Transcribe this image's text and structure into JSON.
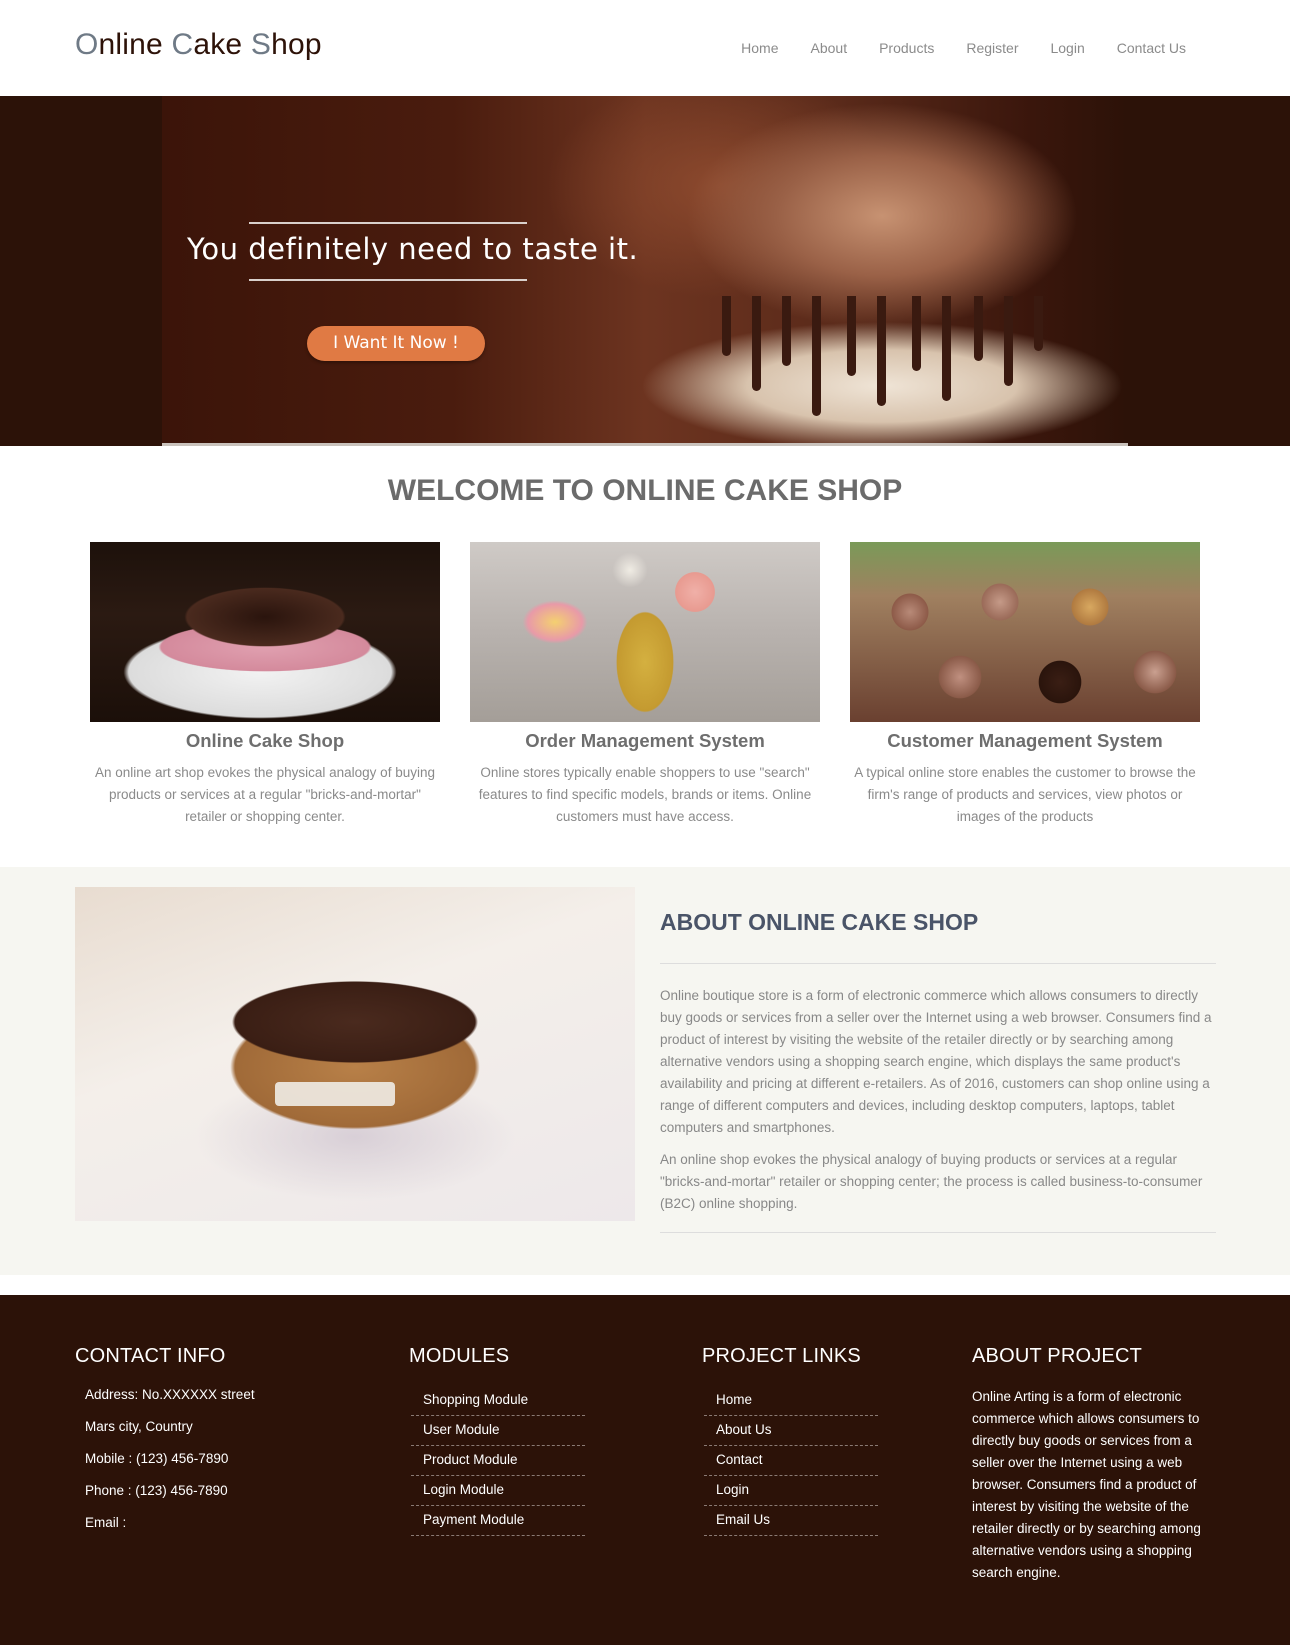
{
  "header": {
    "logo_parts": [
      {
        "cap": "O",
        "rest": "nline "
      },
      {
        "cap": "C",
        "rest": "ake "
      },
      {
        "cap": "S",
        "rest": "hop"
      }
    ],
    "nav": [
      "Home",
      "About",
      "Products",
      "Register",
      "Login",
      "Contact Us"
    ]
  },
  "hero": {
    "tagline": "You definitely need to taste it.",
    "cta_label": "I Want It Now !",
    "cta_color": "#e07a44"
  },
  "welcome": {
    "title": "WELCOME TO ONLINE CAKE SHOP",
    "cards": [
      {
        "title": "Online Cake Shop",
        "text": "An online art shop evokes the physical analogy of buying products or services at a regular \"bricks-and-mortar\" retailer or shopping center."
      },
      {
        "title": "Order Management System",
        "text": "Online stores typically enable shoppers to use \"search\" features to find specific models, brands or items. Online customers must have access."
      },
      {
        "title": "Customer Management System",
        "text": "A typical online store enables the customer to browse the firm's range of products and services, view photos or images of the products"
      }
    ]
  },
  "about": {
    "title": "ABOUT ONLINE CAKE SHOP",
    "paragraphs": [
      "Online boutique store is a form of electronic commerce which allows consumers to directly buy goods or services from a seller over the Internet using a web browser. Consumers find a product of interest by visiting the website of the retailer directly or by searching among alternative vendors using a shopping search engine, which displays the same product's availability and pricing at different e-retailers. As of 2016, customers can shop online using a range of different computers and devices, including desktop computers, laptops, tablet computers and smartphones.",
      "An online shop evokes the physical analogy of buying products or services at a regular \"bricks-and-mortar\" retailer or shopping center; the process is called business-to-consumer (B2C) online shopping."
    ]
  },
  "footer": {
    "contact": {
      "title": "CONTACT INFO",
      "lines": [
        "Address: No.XXXXXX street",
        "Mars city, Country",
        "Mobile : (123) 456-7890",
        "Phone : (123) 456-7890",
        "Email :"
      ]
    },
    "modules": {
      "title": "MODULES",
      "items": [
        "Shopping Module",
        "User Module",
        "Product Module",
        "Login Module",
        "Payment Module"
      ]
    },
    "links": {
      "title": "PROJECT LINKS",
      "items": [
        "Home",
        "About Us",
        "Contact",
        "Login",
        "Email Us"
      ]
    },
    "about_project": {
      "title": "ABOUT PROJECT",
      "text": "Online Arting is a form of electronic commerce which allows consumers to directly buy goods or services from a seller over the Internet using a web browser. Consumers find a product of interest by visiting the website of the retailer directly or by searching among alternative vendors using a shopping search engine."
    }
  },
  "colors": {
    "brand_dark": "#2c1208",
    "accent": "#e07a44",
    "about_bg": "#f6f6f1"
  }
}
